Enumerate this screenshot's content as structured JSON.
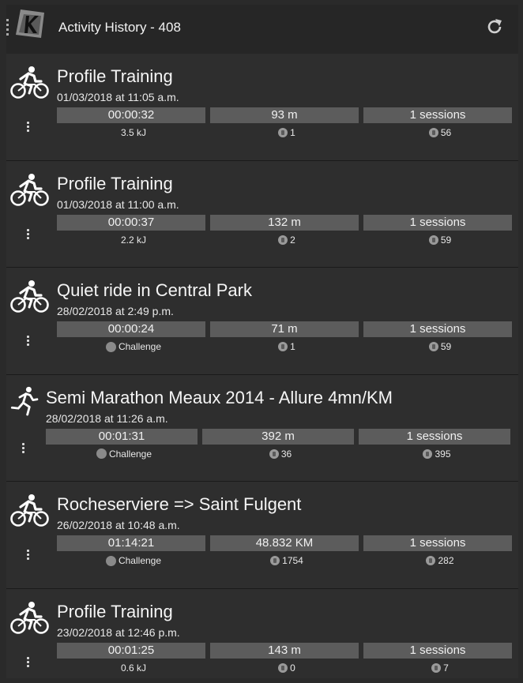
{
  "app": {
    "title": "Activity History - 408"
  },
  "activities": [
    {
      "sport": "cycling",
      "title": "Profile Training",
      "date": "01/03/2018 at 11:05 a.m.",
      "duration": "00:00:32",
      "distance": "93 m",
      "sessions": "1 sessions",
      "extra": "3.5 kJ",
      "stat_a": "1",
      "stat_b": "56"
    },
    {
      "sport": "cycling",
      "title": "Profile Training",
      "date": "01/03/2018 at 11:00 a.m.",
      "duration": "00:00:37",
      "distance": "132 m",
      "sessions": "1 sessions",
      "extra": "2.2 kJ",
      "stat_a": "2",
      "stat_b": "59"
    },
    {
      "sport": "cycling",
      "title": "Quiet ride in Central Park",
      "date": "28/02/2018 at 2:49 p.m.",
      "duration": "00:00:24",
      "distance": "71 m",
      "sessions": "1 sessions",
      "extra": "Challenge",
      "stat_a": "1",
      "stat_b": "59"
    },
    {
      "sport": "running",
      "title": "Semi Marathon Meaux 2014 - Allure 4mn/KM",
      "date": "28/02/2018 at 11:26 a.m.",
      "duration": "00:01:31",
      "distance": "392 m",
      "sessions": "1 sessions",
      "extra": "Challenge",
      "stat_a": "36",
      "stat_b": "395"
    },
    {
      "sport": "cycling",
      "title": "Rocheserviere => Saint Fulgent",
      "date": "26/02/2018 at 10:48 a.m.",
      "duration": "01:14:21",
      "distance": "48.832 KM",
      "sessions": "1 sessions",
      "extra": "Challenge",
      "stat_a": "1754",
      "stat_b": "282"
    },
    {
      "sport": "cycling",
      "title": "Profile Training",
      "date": "23/02/2018 at 12:46 p.m.",
      "duration": "00:01:25",
      "distance": "143 m",
      "sessions": "1 sessions",
      "extra": "0.6 kJ",
      "stat_a": "0",
      "stat_b": "7"
    }
  ]
}
